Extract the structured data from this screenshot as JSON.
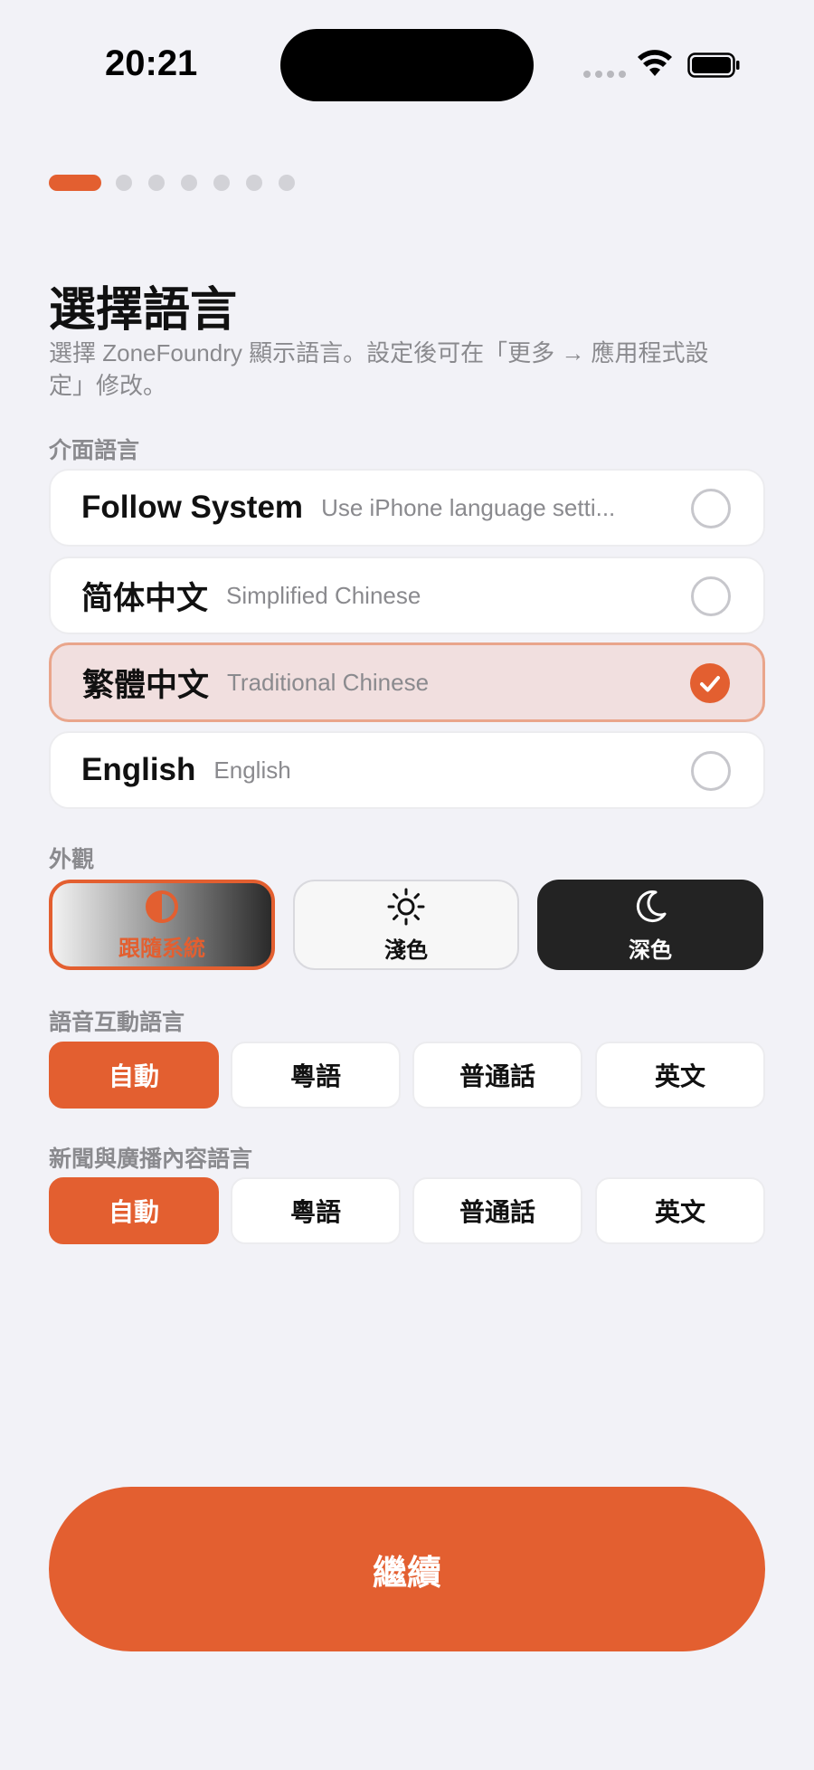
{
  "status_bar": {
    "time": "20:21"
  },
  "onboarding": {
    "total_steps": 7,
    "current_step": 1
  },
  "header": {
    "title": "選擇語言",
    "subtitle": "選擇 ZoneFoundry 顯示語言。設定後可在「更多 → 應用程式設定」修改。"
  },
  "interface_language": {
    "label": "介面語言",
    "options": [
      {
        "name": "Follow System",
        "sub": "Use iPhone language setti...",
        "selected": false
      },
      {
        "name": "简体中文",
        "sub": "Simplified Chinese",
        "selected": false
      },
      {
        "name": "繁體中文",
        "sub": "Traditional Chinese",
        "selected": true
      },
      {
        "name": "English",
        "sub": "English",
        "selected": false
      }
    ]
  },
  "appearance": {
    "label": "外觀",
    "options": [
      {
        "label": "跟隨系統",
        "icon": "half-circle-icon",
        "selected": true
      },
      {
        "label": "淺色",
        "icon": "sun-icon",
        "selected": false
      },
      {
        "label": "深色",
        "icon": "moon-icon",
        "selected": false
      }
    ]
  },
  "voice_language": {
    "label": "語音互動語言",
    "options": [
      "自動",
      "粵語",
      "普通話",
      "英文"
    ],
    "selected": "自動"
  },
  "news_language": {
    "label": "新聞與廣播內容語言",
    "options": [
      "自動",
      "粵語",
      "普通話",
      "英文"
    ],
    "selected": "自動"
  },
  "continue_label": "繼續",
  "colors": {
    "accent": "#e35f30",
    "background": "#f2f2f7"
  }
}
